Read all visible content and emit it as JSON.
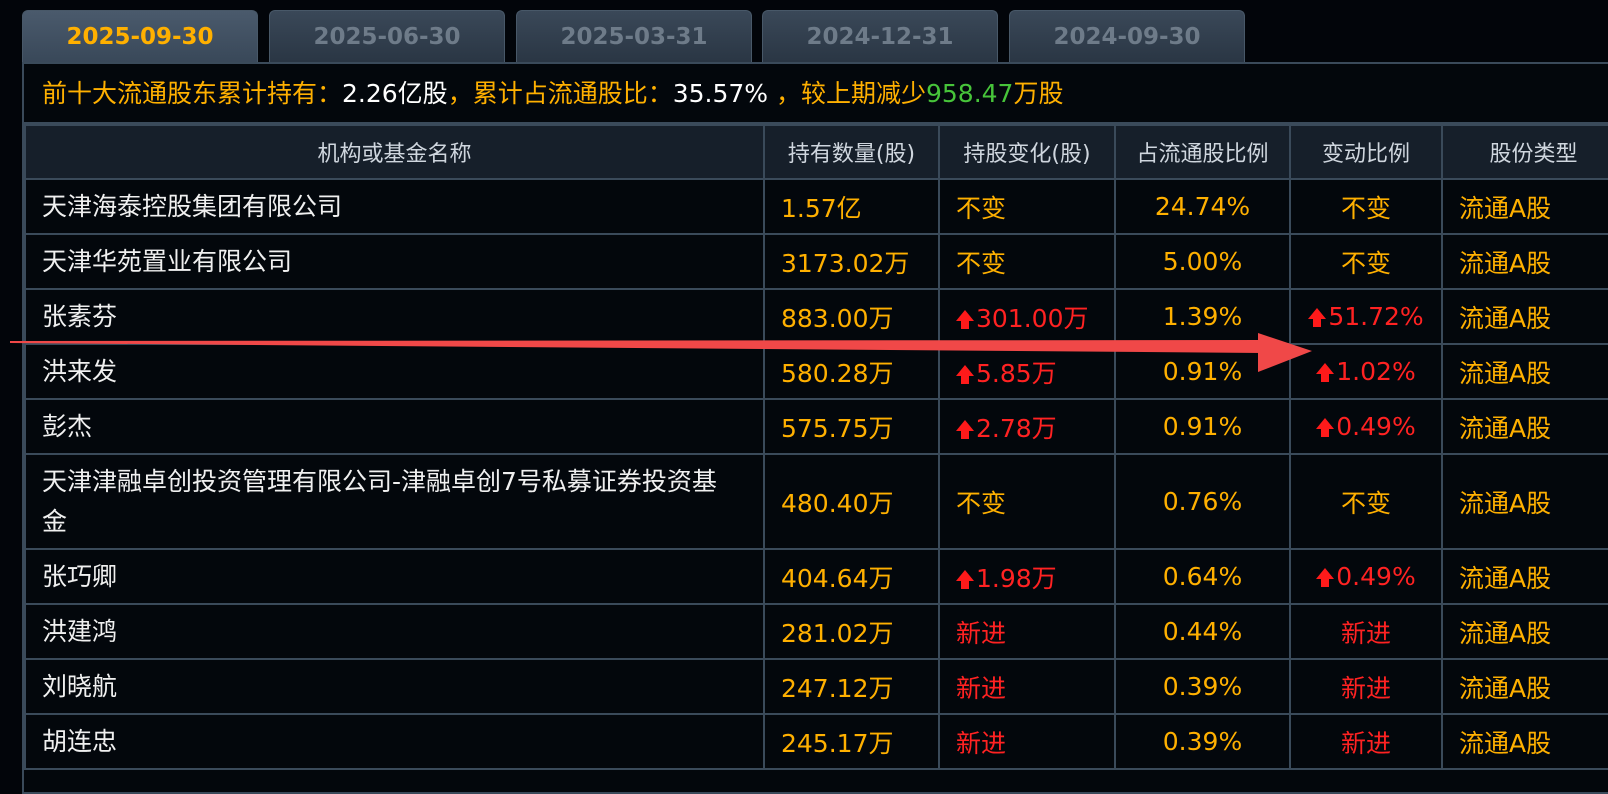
{
  "tabs": [
    "2025-09-30",
    "2025-06-30",
    "2025-03-31",
    "2024-12-31",
    "2024-09-30"
  ],
  "summary": {
    "label_hold": "前十大流通股东累计持有：",
    "hold_value": "2.26亿股",
    "label_ratio": "，累计占流通股比：",
    "ratio_value": "35.57%",
    "label_change": " ，较上期减少",
    "change_value": "958.47",
    "change_unit": "万股"
  },
  "table": {
    "headers": [
      "机构或基金名称",
      "持有数量(股)",
      "持股变化(股)",
      "占流通股比例",
      "变动比例",
      "股份类型"
    ],
    "rows": [
      {
        "name": "天津海泰控股集团有限公司",
        "qty": "1.57亿",
        "change": "不变",
        "change_up": false,
        "change_red": false,
        "ratio": "24.74%",
        "change_ratio": "不变",
        "ratio_up": false,
        "ratio_red": false,
        "type": "流通A股"
      },
      {
        "name": "天津华苑置业有限公司",
        "qty": "3173.02万",
        "change": "不变",
        "change_up": false,
        "change_red": false,
        "ratio": "5.00%",
        "change_ratio": "不变",
        "ratio_up": false,
        "ratio_red": false,
        "type": "流通A股"
      },
      {
        "name": "张素芬",
        "qty": "883.00万",
        "change": "301.00万",
        "change_up": true,
        "change_red": true,
        "ratio": "1.39%",
        "change_ratio": "51.72%",
        "ratio_up": true,
        "ratio_red": true,
        "type": "流通A股"
      },
      {
        "name": "洪来发",
        "qty": "580.28万",
        "change": "5.85万",
        "change_up": true,
        "change_red": true,
        "ratio": "0.91%",
        "change_ratio": "1.02%",
        "ratio_up": true,
        "ratio_red": true,
        "type": "流通A股"
      },
      {
        "name": "彭杰",
        "qty": "575.75万",
        "change": "2.78万",
        "change_up": true,
        "change_red": true,
        "ratio": "0.91%",
        "change_ratio": "0.49%",
        "ratio_up": true,
        "ratio_red": true,
        "type": "流通A股"
      },
      {
        "name": "天津津融卓创投资管理有限公司-津融卓创7号私募证券投资基金",
        "qty": "480.40万",
        "change": "不变",
        "change_up": false,
        "change_red": false,
        "ratio": "0.76%",
        "change_ratio": "不变",
        "ratio_up": false,
        "ratio_red": false,
        "type": "流通A股",
        "tall": true
      },
      {
        "name": "张巧卿",
        "qty": "404.64万",
        "change": "1.98万",
        "change_up": true,
        "change_red": true,
        "ratio": "0.64%",
        "change_ratio": "0.49%",
        "ratio_up": true,
        "ratio_red": true,
        "type": "流通A股"
      },
      {
        "name": "洪建鸿",
        "qty": "281.02万",
        "change": "新进",
        "change_up": false,
        "change_red": true,
        "ratio": "0.44%",
        "change_ratio": "新进",
        "ratio_up": false,
        "ratio_red": true,
        "type": "流通A股"
      },
      {
        "name": "刘晓航",
        "qty": "247.12万",
        "change": "新进",
        "change_up": false,
        "change_red": true,
        "ratio": "0.39%",
        "change_ratio": "新进",
        "ratio_up": false,
        "ratio_red": true,
        "type": "流通A股"
      },
      {
        "name": "胡连忠",
        "qty": "245.17万",
        "change": "新进",
        "change_up": false,
        "change_red": true,
        "ratio": "0.39%",
        "change_ratio": "新进",
        "ratio_up": false,
        "ratio_red": true,
        "type": "流通A股"
      }
    ]
  },
  "colors": {
    "accent": "#ffb000",
    "up": "#ff2222",
    "green": "#47c43a",
    "annotation": "#f04848"
  }
}
